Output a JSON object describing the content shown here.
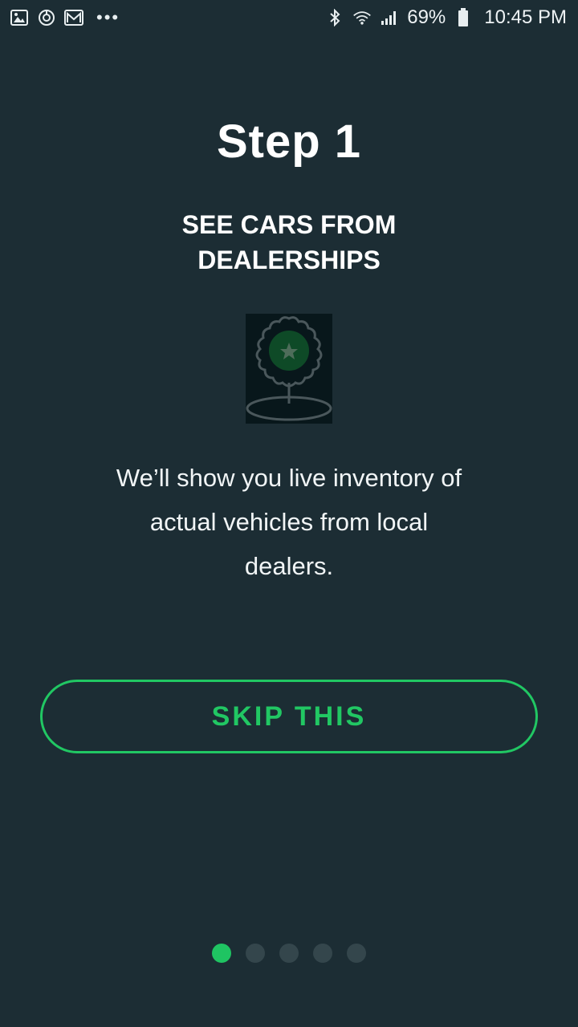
{
  "status_bar": {
    "left_icons": [
      "gallery-icon",
      "sync-icon",
      "gmail-icon"
    ],
    "more": "•••",
    "right_icons": [
      "bluetooth-icon",
      "wifi-icon",
      "signal-icon"
    ],
    "battery_percent": "69%",
    "time": "10:45 PM"
  },
  "onboarding": {
    "title": "Step 1",
    "subtitle": "SEE CARS FROM DEALERSHIPS",
    "hero_icon": "dealership-badge-icon",
    "description": "We’ll show you live inventory of actual vehicles from local dealers.",
    "skip_label": "SKIP THIS",
    "pager": {
      "total": 5,
      "current": 1
    }
  },
  "colors": {
    "background": "#1c2d34",
    "accent": "#21c763",
    "dot_inactive": "#34464c"
  }
}
